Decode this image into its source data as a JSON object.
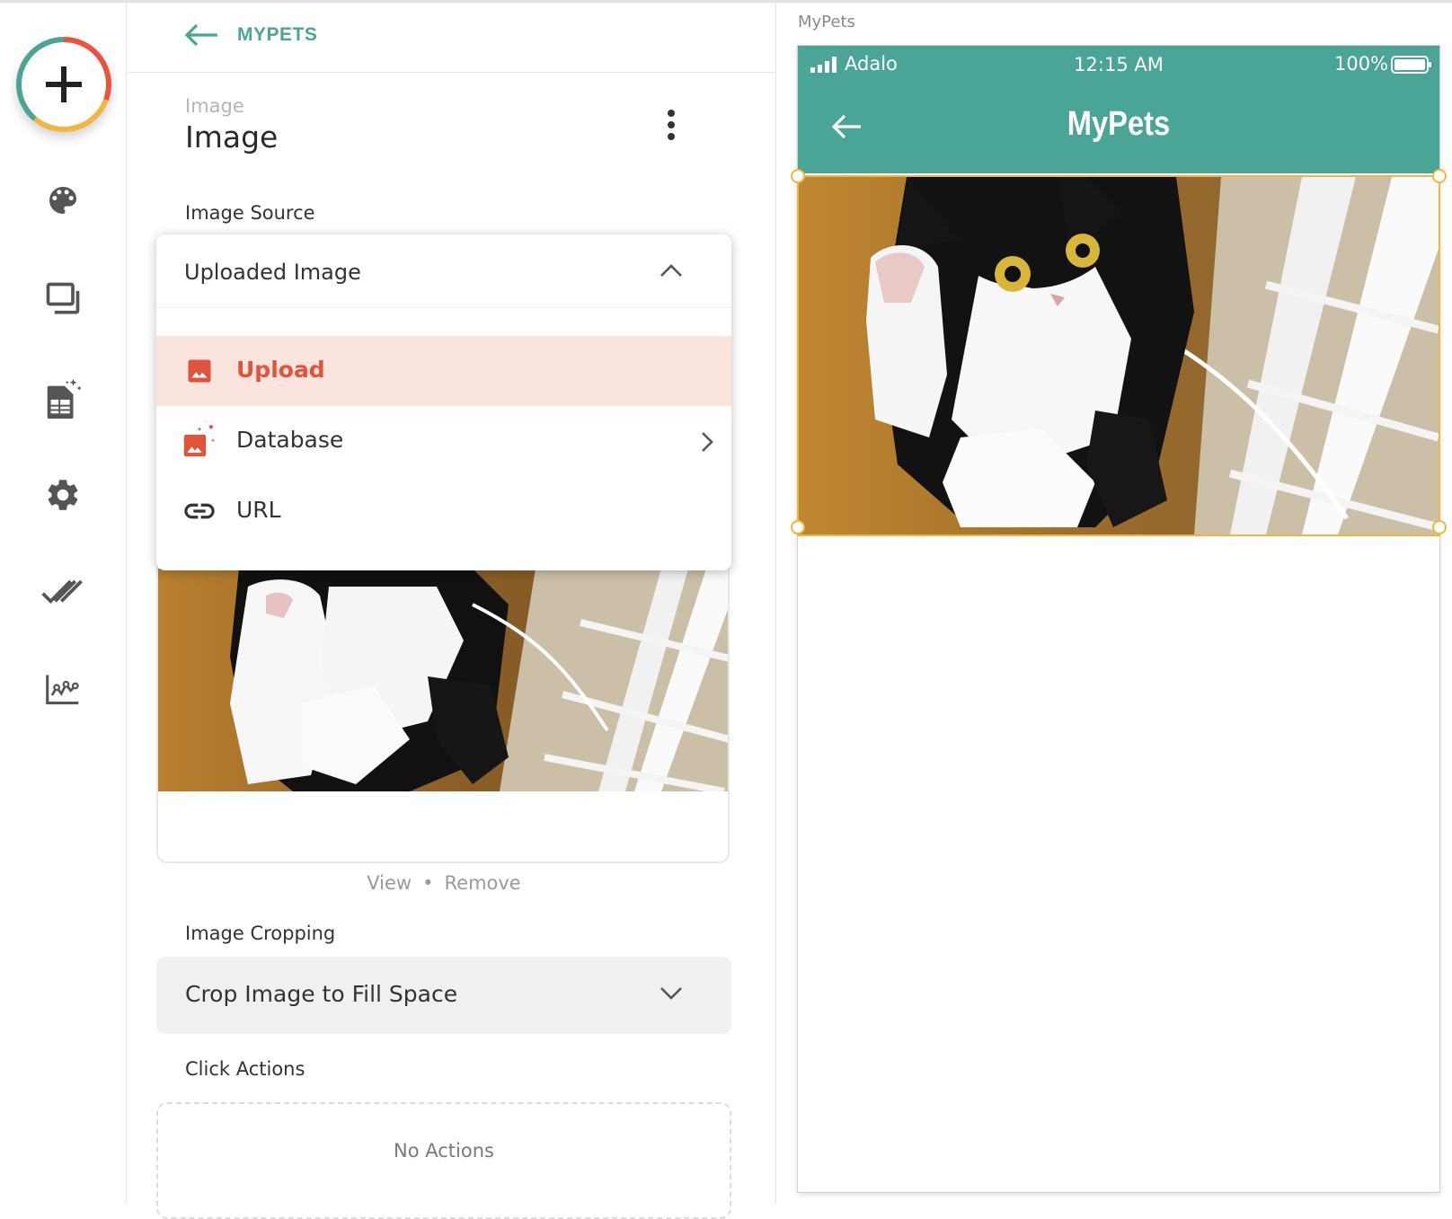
{
  "colors": {
    "accent": "#4aa597",
    "danger": "#e0533c",
    "selection": "#f0b63f",
    "active_bg": "#fbe3de"
  },
  "rail": {
    "icons": [
      "add-icon",
      "palette-icon",
      "screens-icon",
      "database-icon",
      "settings-icon",
      "publish-check-icon",
      "analytics-icon"
    ]
  },
  "panel": {
    "back_label": "MYPETS",
    "component_type": "Image",
    "component_name": "Image",
    "image_source_label": "Image Source",
    "image_source": {
      "selected": "Uploaded Image",
      "options": [
        {
          "label": "Upload",
          "icon": "image-icon",
          "active": true
        },
        {
          "label": "Database",
          "icon": "magic-image-icon",
          "has_submenu": true
        },
        {
          "label": "URL",
          "icon": "link-icon"
        }
      ]
    },
    "view_label": "View",
    "separator": "•",
    "remove_label": "Remove",
    "image_cropping_label": "Image Cropping",
    "image_cropping_value": "Crop Image to Fill Space",
    "click_actions_label": "Click Actions",
    "no_actions_text": "No Actions"
  },
  "preview": {
    "screen_name": "MyPets",
    "status": {
      "carrier": "Adalo",
      "time": "12:15 AM",
      "battery": "100%"
    },
    "app_title": "MyPets"
  }
}
